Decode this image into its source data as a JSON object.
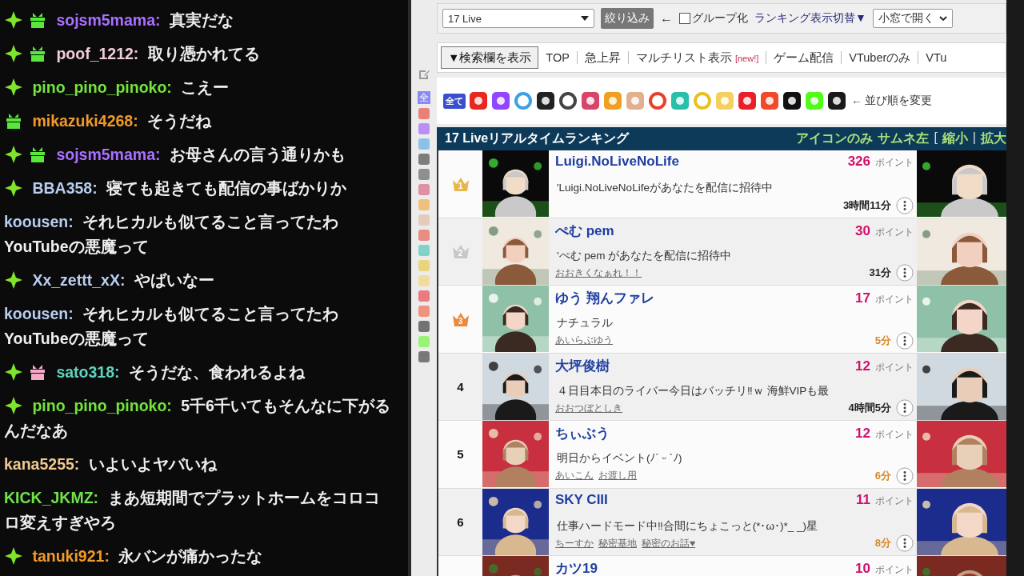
{
  "chat": [
    {
      "badges": [
        {
          "kind": "diamond"
        },
        {
          "kind": "gift",
          "color": "#57e83a"
        }
      ],
      "user": "sojsm5mama:",
      "color": "#a970ff",
      "text": "真実だな"
    },
    {
      "badges": [
        {
          "kind": "diamond"
        },
        {
          "kind": "gift",
          "color": "#57e83a"
        }
      ],
      "user": "poof_1212:",
      "color": "#f2cdd6",
      "text": "取り憑かれてる"
    },
    {
      "badges": [
        {
          "kind": "diamond"
        }
      ],
      "user": "pino_pino_pinoko:",
      "color": "#74e43c",
      "text": "こえー"
    },
    {
      "badges": [
        {
          "kind": "gift",
          "color": "#57e83a"
        }
      ],
      "user": "mikazuki4268:",
      "color": "#f39a28",
      "text": "そうだね"
    },
    {
      "badges": [
        {
          "kind": "diamond"
        },
        {
          "kind": "gift",
          "color": "#57e83a"
        }
      ],
      "user": "sojsm5mama:",
      "color": "#a970ff",
      "text": "お母さんの言う通りかも"
    },
    {
      "badges": [
        {
          "kind": "diamond"
        }
      ],
      "user": "BBA358:",
      "color": "#b9cdef",
      "text": "寝ても起きても配信の事ばかりか"
    },
    {
      "user": "koousen:",
      "color": "#b9cdef",
      "text": "それヒカルも似てること言ってたわYouTubeの悪魔って"
    },
    {
      "badges": [
        {
          "kind": "diamond"
        }
      ],
      "user": "Xx_zettt_xX:",
      "color": "#b9cdef",
      "text": "やばいなー"
    },
    {
      "user": "koousen:",
      "color": "#b9cdef",
      "text": "それヒカルも似てること言ってたわYouTubeの悪魔って"
    },
    {
      "badges": [
        {
          "kind": "diamond"
        },
        {
          "kind": "gift",
          "color": "#f4a9c9"
        }
      ],
      "user": "sato318:",
      "color": "#5fd3c0",
      "text": "そうだな、食われるよね"
    },
    {
      "badges": [
        {
          "kind": "diamond"
        }
      ],
      "user": "pino_pino_pinoko:",
      "color": "#74e43c",
      "text": "5千6千いてもそんなに下がるんだなあ"
    },
    {
      "user": "kana5255:",
      "color": "#f1c98f",
      "text": "いよいよヤバいね"
    },
    {
      "user": "KICK_JKMZ:",
      "color": "#6fe24a",
      "text": "まあ短期間でプラットホームをコロコロ変えすぎやろ"
    },
    {
      "badges": [
        {
          "kind": "diamond"
        }
      ],
      "user": "tanuki921:",
      "color": "#f39a28",
      "text": "永バンが痛かったな"
    }
  ],
  "toolbar": {
    "platform_select": "17 Live",
    "filter_button": "絞り込み",
    "arrow": "←",
    "group": {
      "label": "グループ化",
      "checked": false
    },
    "display_toggle": "ランキング表示切替▼",
    "open_select": "小窓で開く"
  },
  "nav": {
    "search_toggle": "▼検索欄を表示",
    "links": [
      {
        "label": "TOP"
      },
      {
        "label": "急上昇"
      },
      {
        "label": "マルチリスト表示",
        "badge": "[new!]"
      },
      {
        "label": "ゲーム配信"
      },
      {
        "label": "VTuberのみ"
      },
      {
        "label": "VTu"
      }
    ]
  },
  "sidebar": {
    "all_label": "全"
  },
  "platforms": [
    {
      "kind": "text",
      "label": "全て",
      "color": "#3a4fd0"
    },
    {
      "kind": "logo",
      "color": "#e8281e"
    },
    {
      "kind": "logo",
      "color": "#9146ff"
    },
    {
      "kind": "ring",
      "color": "#3aa0e8"
    },
    {
      "kind": "logo",
      "color": "#222222"
    },
    {
      "kind": "ring",
      "color": "#444444"
    },
    {
      "kind": "logo",
      "color": "#d8456a"
    },
    {
      "kind": "logo",
      "color": "#f0a020"
    },
    {
      "kind": "logo",
      "color": "#e0b090"
    },
    {
      "kind": "ring",
      "color": "#e8402a"
    },
    {
      "kind": "logo",
      "color": "#28c0a8"
    },
    {
      "kind": "ring",
      "color": "#e8c020"
    },
    {
      "kind": "logo",
      "color": "#f4d060"
    },
    {
      "kind": "logo",
      "color": "#e8202a"
    },
    {
      "kind": "logo",
      "color": "#f04a28"
    },
    {
      "kind": "logo",
      "color": "#111111"
    },
    {
      "kind": "logo",
      "color": "#53fc18"
    },
    {
      "kind": "logo",
      "color": "#1a1a1a"
    }
  ],
  "sort_hint": "← 並び順を変更",
  "ranking": {
    "title": "17 Liveリアルタイムランキング",
    "views": [
      {
        "label": "アイコンのみ"
      },
      {
        "label": "サムネ左"
      }
    ],
    "bracket": "[",
    "sizes": [
      {
        "label": "縮小"
      },
      {
        "label": "拡大"
      }
    ],
    "separator": "|",
    "rows": [
      {
        "rank": {
          "kind": "crown",
          "label": "1",
          "color": "#e8b64c"
        },
        "name": "Luigi.NoLiveNoLife",
        "points": "326",
        "unit": "ポイント",
        "description": "'Luigi.NoLiveNoLifeがあなたを配信に招待中",
        "tags": [],
        "time": "3時間11分",
        "recent": false
      },
      {
        "rank": {
          "kind": "crown",
          "label": "2",
          "color": "#c8c8c8"
        },
        "name": "ぺむ pem",
        "points": "30",
        "unit": "ポイント",
        "description": "'ぺむ pem があなたを配信に招待中",
        "tags": [
          "おおきくなぁれ！！"
        ],
        "time": "31分",
        "recent": false
      },
      {
        "rank": {
          "kind": "crown",
          "label": "3",
          "color": "#eb8a3a"
        },
        "name": "ゆう 翔んファレ",
        "points": "17",
        "unit": "ポイント",
        "description": "ナチュラル",
        "tags": [
          "あいらぶゆう"
        ],
        "time": "5分",
        "recent": true
      },
      {
        "rank": {
          "kind": "number",
          "label": "4"
        },
        "name": "大坪俊樹",
        "points": "12",
        "unit": "ポイント",
        "description": "４日目本日のライバー今日はバッチリ‼ｗ 海鮮VIPも最",
        "tags": [
          "おおつぼとしき"
        ],
        "time": "4時間5分",
        "recent": false
      },
      {
        "rank": {
          "kind": "number",
          "label": "5"
        },
        "name": "ちぃぶう",
        "points": "12",
        "unit": "ポイント",
        "description": "明日からイベント(ﾉ´ ᵕ `ﾉ)",
        "tags": [
          "あいこん",
          "お渡し用"
        ],
        "time": "6分",
        "recent": true
      },
      {
        "rank": {
          "kind": "number",
          "label": "6"
        },
        "name": "SKY CIII",
        "points": "11",
        "unit": "ポイント",
        "description": "仕事ハードモード中‼合間にちょこっと(*･ω･)*_ _)星",
        "tags": [
          "ちーすか",
          "秘密基地",
          "秘密のお話♥"
        ],
        "time": "8分",
        "recent": true
      },
      {
        "rank": {
          "kind": "number"
        },
        "name": "カツ19",
        "points": "10",
        "unit": "ポイント"
      }
    ]
  }
}
